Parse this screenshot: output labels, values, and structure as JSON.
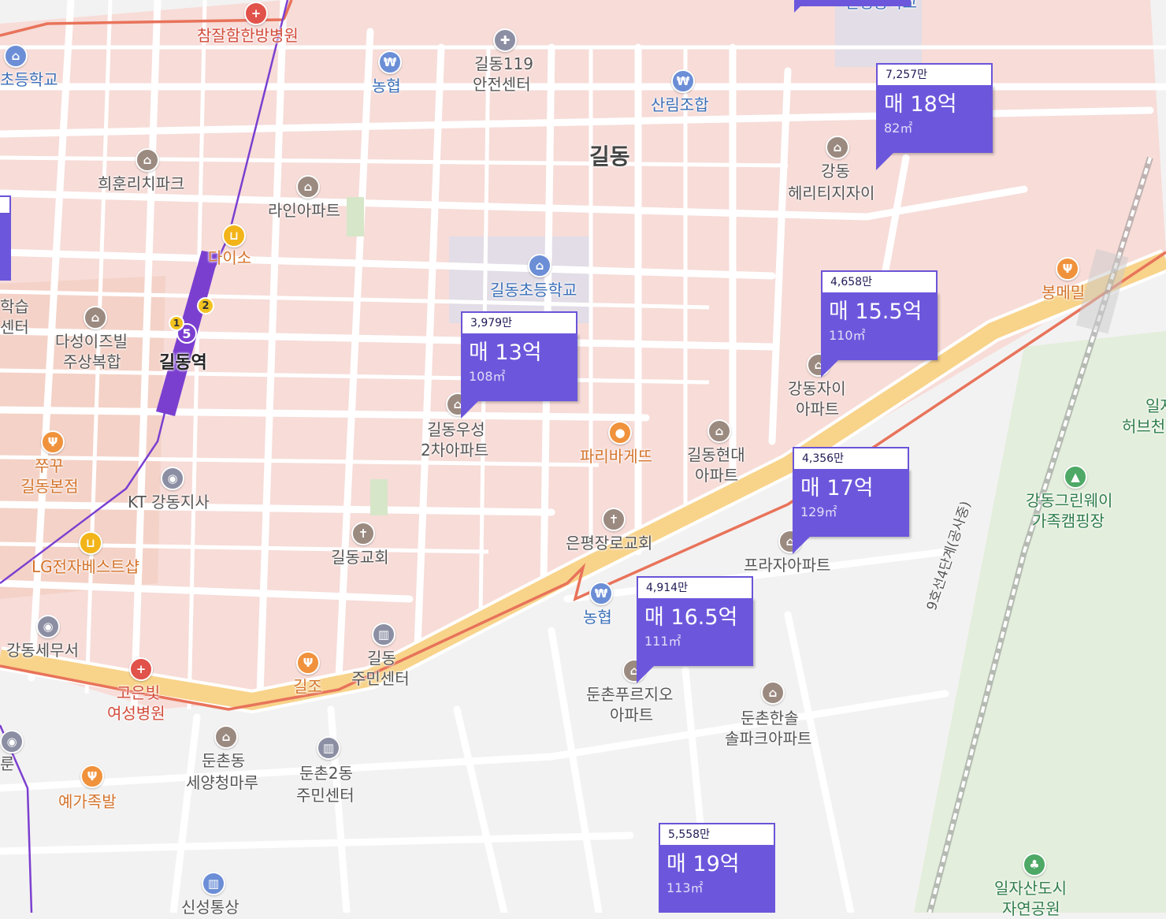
{
  "district_label": "길동",
  "station": {
    "name": "길동역",
    "line_number": "5",
    "exit_1": "1",
    "exit_2": "2"
  },
  "listings": [
    {
      "price_per": "7,257만",
      "sale": "매 18억",
      "area": "82㎡"
    },
    {
      "price_per": "4,658만",
      "sale": "매 15.5억",
      "area": "110㎡"
    },
    {
      "price_per": "3,979만",
      "sale": "매 13억",
      "area": "108㎡"
    },
    {
      "price_per": "4,356만",
      "sale": "매 17억",
      "area": "129㎡"
    },
    {
      "price_per": "4,914만",
      "sale": "매 16.5억",
      "area": "111㎡"
    },
    {
      "price_per": "5,558만",
      "sale": "매 19억",
      "area": "113㎡"
    }
  ],
  "places": {
    "hospital_top": "참잘함한방병원",
    "school_left": "초등학교",
    "nonghyup_top": "농협",
    "fire_station_1": "길동119",
    "fire_station_2": "안전센터",
    "sanrim": "산림조합",
    "school_top": "신명중학교",
    "heehoon": "희훈리치파크",
    "line_apt": "라인아파트",
    "daiso": "다이소",
    "gildong_school": "길동초등학교",
    "heritage_1": "강동",
    "heritage_2": "헤리티지자이",
    "bongmemil": "봉메밀",
    "learning_1": "학습",
    "learning_2": "센터",
    "dasung_1": "다성이즈빌",
    "dasung_2": "주상복합",
    "gildong_xi_1": "강동자이",
    "gildong_xi_2": "아파트",
    "woosung_1": "길동우성",
    "woosung_2": "2차아파트",
    "paris": "파리바게뜨",
    "hyundai_1": "길동현대",
    "hyundai_2": "아파트",
    "jjugu_1": "쭈꾸",
    "jjugu_2": "길동본점",
    "kt": "KT 강동지사",
    "ilja_1": "일자",
    "ilja_2": "허브천",
    "camping_1": "강동그린웨이",
    "camping_2": "가족캠핑장",
    "church_eunpyung": "은평장로교회",
    "praza": "프라자아파트",
    "lg": "LG전자베스트샵",
    "gildong_church": "길동교회",
    "nonghyup_bottom": "농협",
    "tax_office": "강동세무서",
    "gildong_center_1": "길동",
    "gildong_center_2": "주민센터",
    "giljo": "길조",
    "goeun_1": "고은빛",
    "goeun_2": "여성병원",
    "dunchon_pru_1": "둔촌푸르지오",
    "dunchon_pru_2": "아파트",
    "hansol_1": "둔촌한솔",
    "hansol_2": "솔파크아파트",
    "line9": "9호선4단계(공사중)",
    "dunchon_seyang_1": "둔촌동",
    "dunchon_seyang_2": "세양청마루",
    "dunchon2_1": "둔촌2동",
    "dunchon2_2": "주민센터",
    "yega": "예가족발",
    "left_edge": "룬",
    "shinsung": "신성통상",
    "iljasan_1": "일자산도시",
    "iljasan_2": "자연공원"
  },
  "colors": {
    "residential": "#f7dcd8",
    "road": "#ffffff",
    "main_road": "#f8d38a",
    "boundary": "#e8735a",
    "subway": "#7b3fd0",
    "card": "#6c57dc",
    "park": "#e3eedc"
  }
}
